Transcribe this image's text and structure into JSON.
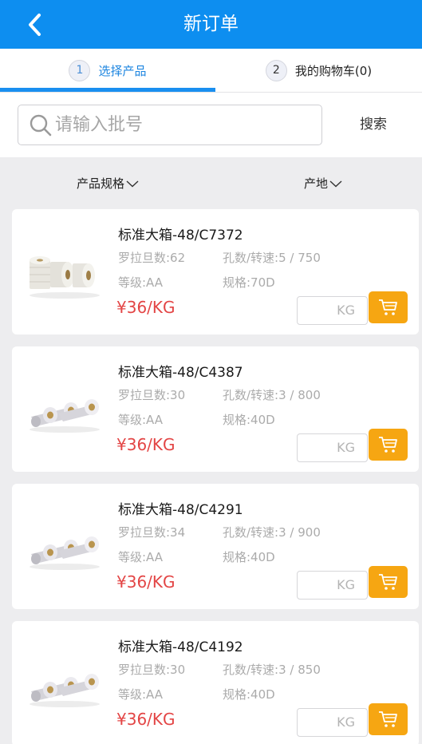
{
  "header": {
    "title": "新订单",
    "back_icon": "chevron-left-icon"
  },
  "tabs": [
    {
      "step": "1",
      "label": "选择产品",
      "active": true
    },
    {
      "step": "2",
      "label": "我的购物车(0)",
      "active": false
    }
  ],
  "search": {
    "placeholder": "请输入批号",
    "value": "",
    "button_label": "搜索",
    "icon": "search-icon"
  },
  "filters": {
    "spec_label": "产品规格",
    "origin_label": "产地"
  },
  "products": [
    {
      "name": "标准大箱-48/C7372",
      "denier": "罗拉旦数:62",
      "holes": "孔数/转速:5 / 750",
      "grade": "等级:AA",
      "spec": "规格:70D",
      "price": "¥36/KG",
      "unit": "KG",
      "image": "stacked-spools"
    },
    {
      "name": "标准大箱-48/C4387",
      "denier": "罗拉旦数:30",
      "holes": "孔数/转速:3 / 800",
      "grade": "等级:AA",
      "spec": "规格:40D",
      "price": "¥36/KG",
      "unit": "KG",
      "image": "row-spools"
    },
    {
      "name": "标准大箱-48/C4291",
      "denier": "罗拉旦数:34",
      "holes": "孔数/转速:3 / 900",
      "grade": "等级:AA",
      "spec": "规格:40D",
      "price": "¥36/KG",
      "unit": "KG",
      "image": "row-spools"
    },
    {
      "name": "标准大箱-48/C4192",
      "denier": "罗拉旦数:30",
      "holes": "孔数/转速:3 / 850",
      "grade": "等级:AA",
      "spec": "规格:40D",
      "price": "¥36/KG",
      "unit": "KG",
      "image": "row-spools"
    }
  ],
  "colors": {
    "primary": "#0d8ef0",
    "price": "#e34545",
    "cart": "#f6a612"
  }
}
